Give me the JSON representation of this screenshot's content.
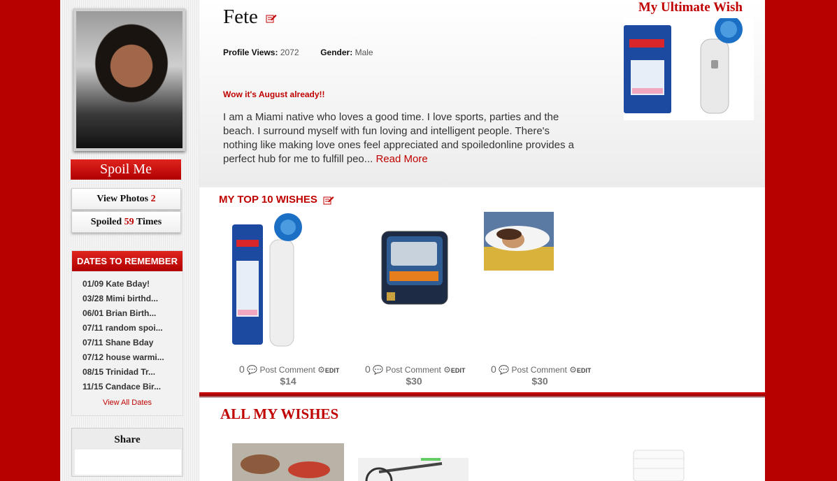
{
  "profile": {
    "name": "Fete",
    "views_label": "Profile Views:",
    "views_value": "2072",
    "gender_label": "Gender:",
    "gender_value": "Male",
    "status": "Wow it's August already!!",
    "bio": "I am a Miami native who loves a good time. I love sports, parties and the beach. I surround myself with fun loving and intelligent people. There's nothing like making love ones feel appreciated and spoiledonline provides a perfect hub for me to fulfill peo...",
    "read_more": "Read More"
  },
  "ultimate_wish": {
    "title": "My Ultimate Wish"
  },
  "sidebar": {
    "spoil_me": "Spoil Me",
    "view_photos_label": "View Photos",
    "view_photos_count": "2",
    "spoiled_label": "Spoiled",
    "spoiled_count": "59",
    "spoiled_suffix": "Times",
    "dates_title": "DATES TO REMEMBER",
    "dates": [
      "01/09 Kate Bday!",
      "03/28 Mimi birthd...",
      "06/01 Brian Birth...",
      "07/11 random spoi...",
      "07/11 Shane Bday",
      "07/12 house warmi...",
      "08/15 Trinidad Tr...",
      "11/15 Candace Bir..."
    ],
    "view_all_dates": "View All Dates",
    "share_title": "Share"
  },
  "top_wishes": {
    "title": "MY TOP 10 WISHES",
    "items": [
      {
        "comments": "0",
        "comment_label": "Post Comment",
        "edit_label": "EDIT",
        "price": "$14",
        "image": "toothbrush-head"
      },
      {
        "comments": "0",
        "comment_label": "Post Comment",
        "edit_label": "EDIT",
        "price": "$30",
        "image": "razor-cartridges"
      },
      {
        "comments": "0",
        "comment_label": "Post Comment",
        "edit_label": "EDIT",
        "price": "$30",
        "image": "pillow"
      }
    ]
  },
  "all_wishes": {
    "title": "ALL MY WISHES"
  },
  "colors": {
    "brand_red": "#b70000",
    "accent_red": "#c00000"
  }
}
